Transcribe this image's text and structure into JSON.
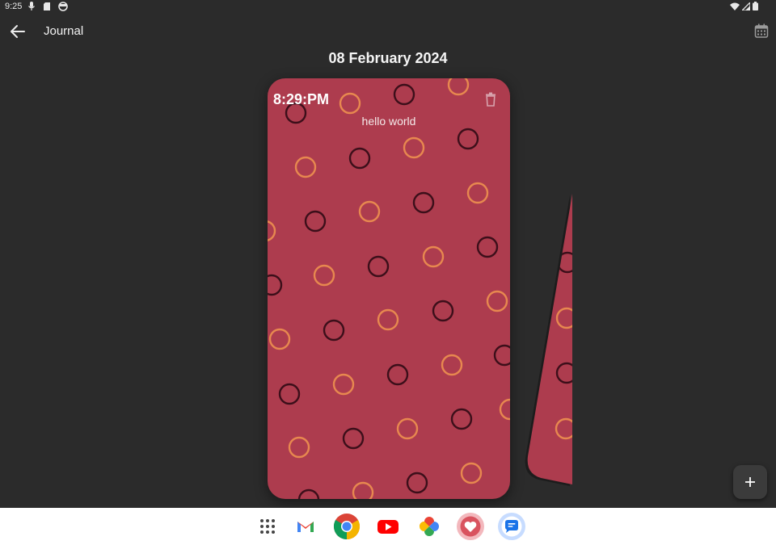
{
  "status_bar": {
    "time": "9:25",
    "left_icons": [
      "mic-icon",
      "sd-card-icon",
      "face-icon"
    ],
    "right_icons": [
      "wifi-icon",
      "signal-icon",
      "battery-icon"
    ]
  },
  "app_bar": {
    "title": "Journal",
    "back_icon": "arrow-left-icon",
    "calendar_icon": "calendar-icon"
  },
  "date_heading": "08 February 2024",
  "entry": {
    "time": "8:29:PM",
    "text": "hello world",
    "delete_icon": "trash-icon",
    "card_color": "#ad3c4e",
    "pattern_colors": {
      "dark_ring": "#3c0f1a",
      "light_ring": "#e7884f"
    }
  },
  "fab": {
    "icon": "plus-icon"
  },
  "taskbar": {
    "apps": [
      {
        "name": "app-drawer",
        "icon": "grid-icon"
      },
      {
        "name": "gmail",
        "icon": "gmail-icon"
      },
      {
        "name": "chrome",
        "icon": "chrome-icon"
      },
      {
        "name": "youtube",
        "icon": "youtube-icon"
      },
      {
        "name": "photos",
        "icon": "photos-icon"
      },
      {
        "name": "health",
        "icon": "heart-icon"
      },
      {
        "name": "messages",
        "icon": "messages-icon"
      }
    ]
  },
  "colors": {
    "background": "#2b2b2b",
    "card": "#ad3c4e",
    "taskbar": "#ffffff"
  }
}
